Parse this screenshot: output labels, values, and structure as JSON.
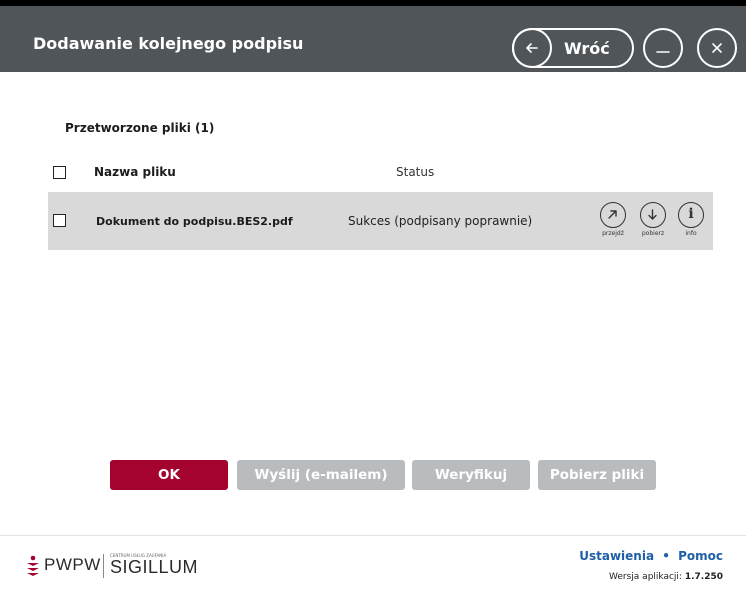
{
  "header": {
    "title": "Dodawanie kolejnego podpisu",
    "back_label": "Wróć"
  },
  "files": {
    "section_title": "Przetworzone pliki (1)",
    "col_name": "Nazwa pliku",
    "col_status": "Status",
    "rows": [
      {
        "name": "Dokument do podpisu.BES2.pdf",
        "status": "Sukces (podpisany poprawnie)",
        "actions": [
          "przejdź",
          "pobierz",
          "info"
        ]
      }
    ]
  },
  "buttons": {
    "ok": "OK",
    "email": "Wyślij (e-mailem)",
    "verify": "Weryfikuj",
    "download": "Pobierz pliki"
  },
  "footer": {
    "logo_pwpw": "PWPW",
    "logo_small": "CENTRUM USŁUG ZAUFANIA",
    "logo_sigillum": "SIGILLUM",
    "settings": "Ustawienia",
    "separator": "•",
    "help": "Pomoc",
    "version_label": "Wersja aplikacji:",
    "version": "1.7.250"
  },
  "colors": {
    "header_bg": "#505559",
    "primary": "#a4032d",
    "disabled": "#b8bcbf",
    "link": "#1f5fa8",
    "row_bg": "#d9d9d9"
  }
}
